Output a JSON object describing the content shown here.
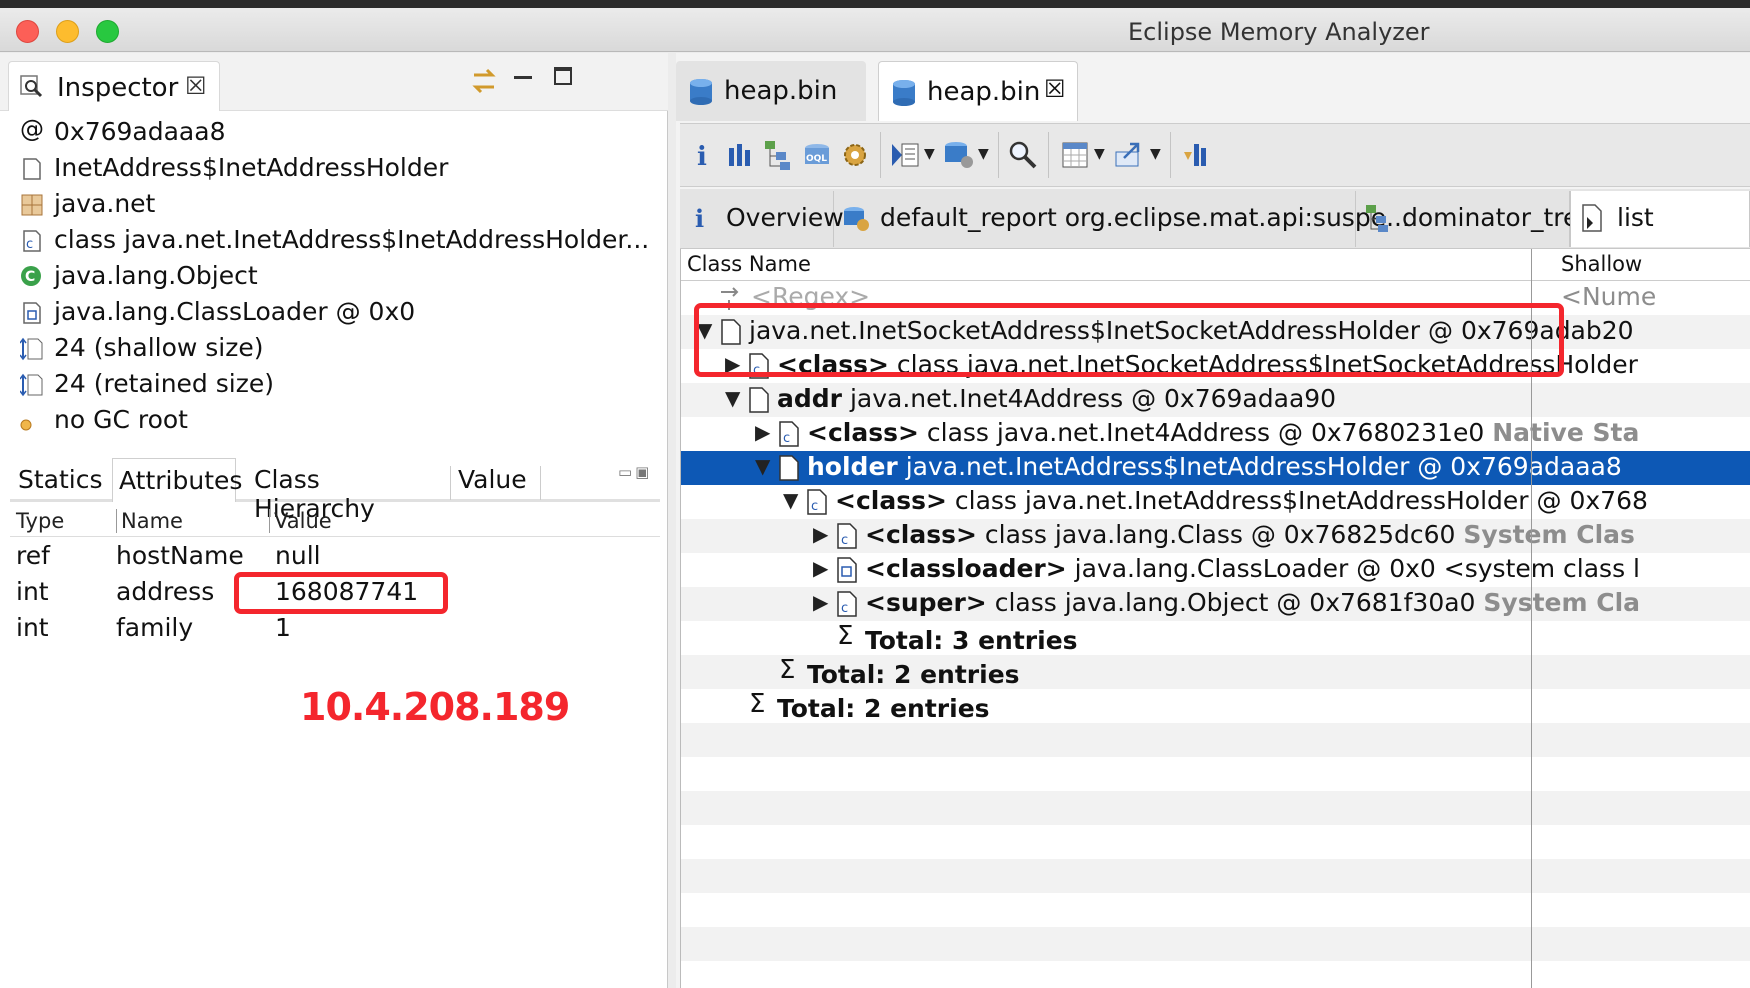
{
  "window": {
    "title": "Eclipse Memory Analyzer"
  },
  "inspector": {
    "tab_label": "Inspector",
    "close_glyph": "☒",
    "attributes": [
      {
        "icon": "at-icon",
        "text": "0x769adaaa8"
      },
      {
        "icon": "object-icon",
        "text": "InetAddress$InetAddressHolder"
      },
      {
        "icon": "package-icon",
        "text": "java.net"
      },
      {
        "icon": "class-icon",
        "text": "class java.net.InetAddress$InetAddressHolder..."
      },
      {
        "icon": "superclass-icon",
        "text": "java.lang.Object"
      },
      {
        "icon": "classloader-icon",
        "text": "java.lang.ClassLoader @ 0x0"
      },
      {
        "icon": "size-icon",
        "text": "24 (shallow size)"
      },
      {
        "icon": "size-icon",
        "text": "24 (retained size)"
      },
      {
        "icon": "gc-root-icon",
        "text": "no GC root"
      }
    ],
    "tabs": [
      "Statics",
      "Attributes",
      "Class Hierarchy",
      "Value"
    ],
    "selected_tab": "Attributes",
    "table": {
      "headers": [
        "Type",
        "Name",
        "Value"
      ],
      "rows": [
        {
          "type": "ref",
          "name": "hostName",
          "value": "null"
        },
        {
          "type": "int",
          "name": "address",
          "value": "168087741"
        },
        {
          "type": "int",
          "name": "family",
          "value": "1"
        }
      ]
    },
    "annotation": "10.4.208.189"
  },
  "editor": {
    "tabs": [
      {
        "label": "heap.bin",
        "active": false
      },
      {
        "label": "heap.bin",
        "active": true,
        "close_glyph": "☒"
      }
    ],
    "subtabs": [
      {
        "icon": "info-icon",
        "label": "Overview"
      },
      {
        "icon": "report-icon",
        "label": "default_report  org.eclipse.mat.api:suspe..."
      },
      {
        "icon": "dominator-tree-icon",
        "label": "dominator_tree"
      },
      {
        "icon": "list-icon",
        "label": "list"
      }
    ],
    "columns": [
      "Class Name",
      "Shallow"
    ],
    "filter_row": {
      "name": "<Regex>",
      "shallow": "<Nume"
    },
    "rows": [
      {
        "twisty": "▼",
        "bold": "",
        "text": "java.net.InetSocketAddress$InetSocketAddressHolder @ 0x769adab20",
        "grey": ""
      },
      {
        "twisty": "▶",
        "bold": "<class>",
        "text": "class java.net.InetSocketAddress$InetSocketAddressHolder",
        "grey": ""
      },
      {
        "twisty": "▼",
        "bold": "addr",
        "text": "java.net.Inet4Address @ 0x769adaa90",
        "grey": ""
      },
      {
        "twisty": "▶",
        "bold": "<class>",
        "text": "class java.net.Inet4Address @ 0x7680231e0",
        "grey": "Native Sta"
      },
      {
        "twisty": "▼",
        "bold": "holder",
        "text": "java.net.InetAddress$InetAddressHolder @ 0x769adaaa8",
        "grey": ""
      },
      {
        "twisty": "▼",
        "bold": "<class>",
        "text": "class java.net.InetAddress$InetAddressHolder @ 0x768",
        "grey": ""
      },
      {
        "twisty": "▶",
        "bold": "<class>",
        "text": "class java.lang.Class @ 0x76825dc60",
        "grey": "System Clas"
      },
      {
        "twisty": "▶",
        "bold": "<classloader>",
        "text": "java.lang.ClassLoader @ 0x0  <system class l",
        "grey": ""
      },
      {
        "twisty": "▶",
        "bold": "<super>",
        "text": "class java.lang.Object @ 0x7681f30a0",
        "grey": "System Cla"
      }
    ],
    "totals": [
      "Total: 3 entries",
      "Total: 2 entries",
      "Total: 2 entries"
    ],
    "sigma": "Σ"
  },
  "colors": {
    "selection": "#0d58b5",
    "highlight": "#f4262d"
  }
}
